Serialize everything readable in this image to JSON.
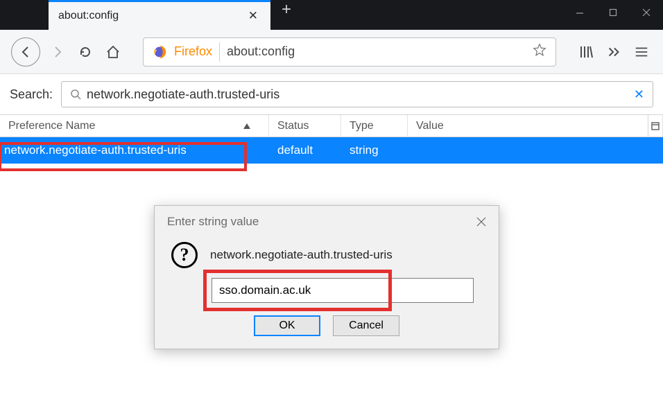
{
  "titlebar": {
    "tab_title": "about:config"
  },
  "toolbar": {
    "firefox_label": "Firefox",
    "url": "about:config"
  },
  "search": {
    "label": "Search:",
    "value": "network.negotiate-auth.trusted-uris"
  },
  "columns": {
    "pref": "Preference Name",
    "status": "Status",
    "type": "Type",
    "value": "Value"
  },
  "row": {
    "name": "network.negotiate-auth.trusted-uris",
    "status": "default",
    "type": "string",
    "value": ""
  },
  "dialog": {
    "title": "Enter string value",
    "pref_name": "network.negotiate-auth.trusted-uris",
    "input_value": "sso.domain.ac.uk",
    "ok": "OK",
    "cancel": "Cancel"
  }
}
